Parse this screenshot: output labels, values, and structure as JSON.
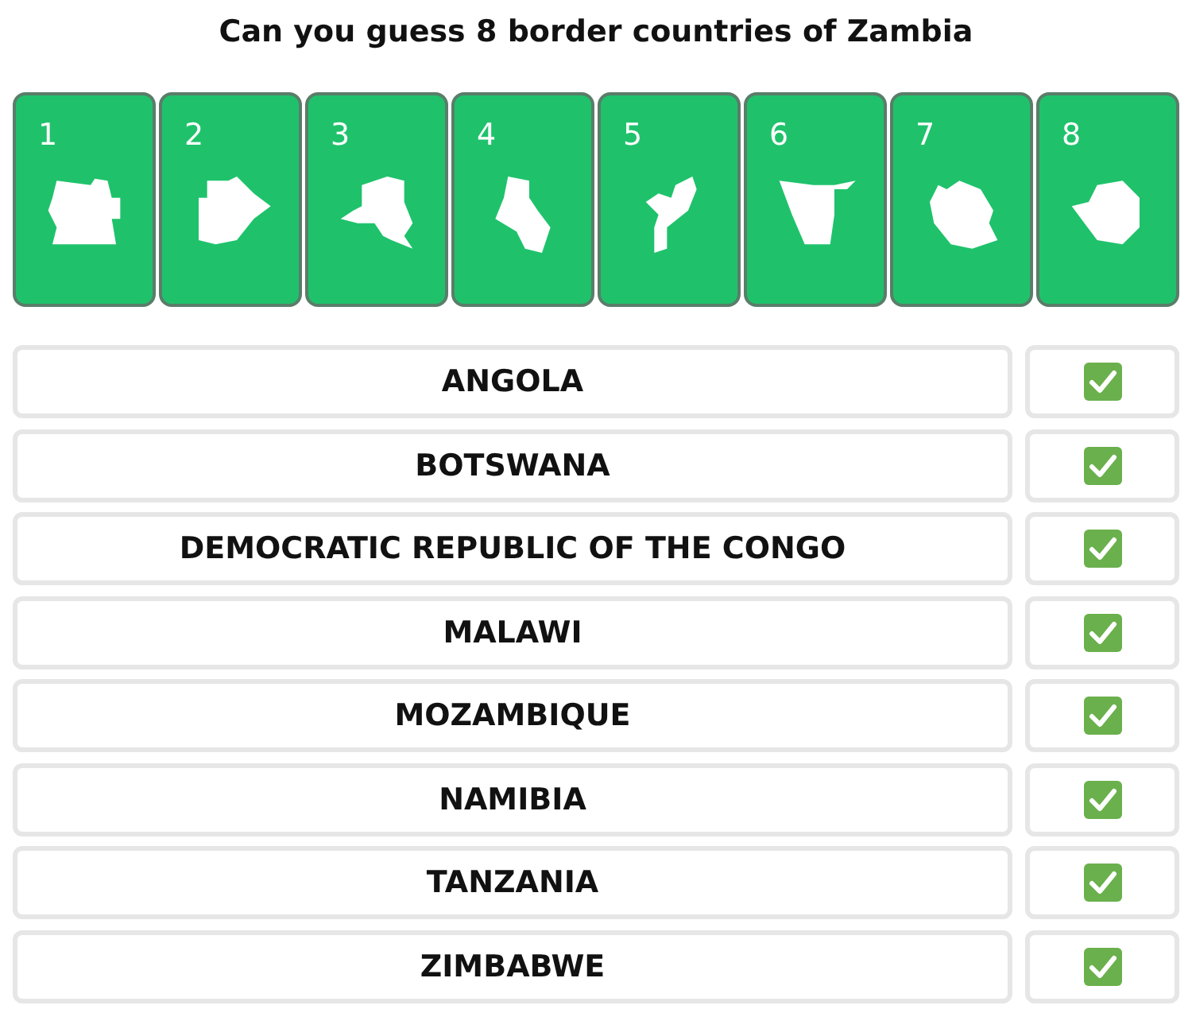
{
  "title": "Can you guess 8 border countries of Zambia",
  "cards": [
    {
      "number": "1"
    },
    {
      "number": "2"
    },
    {
      "number": "3"
    },
    {
      "number": "4"
    },
    {
      "number": "5"
    },
    {
      "number": "6"
    },
    {
      "number": "7"
    },
    {
      "number": "8"
    }
  ],
  "answers": [
    {
      "name": "ANGOLA",
      "checked": true
    },
    {
      "name": "BOTSWANA",
      "checked": true
    },
    {
      "name": "DEMOCRATIC REPUBLIC OF THE CONGO",
      "checked": true
    },
    {
      "name": "MALAWI",
      "checked": true
    },
    {
      "name": "MOZAMBIQUE",
      "checked": true
    },
    {
      "name": "NAMIBIA",
      "checked": true
    },
    {
      "name": "TANZANIA",
      "checked": true
    },
    {
      "name": "ZIMBABWE",
      "checked": true
    }
  ]
}
